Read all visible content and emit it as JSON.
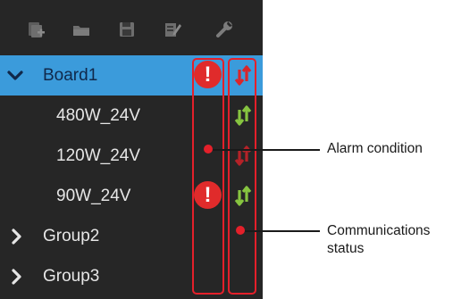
{
  "toolbar": {
    "buttons": [
      {
        "icon": "add-device-icon"
      },
      {
        "icon": "open-folder-icon"
      },
      {
        "icon": "save-disk-icon"
      },
      {
        "icon": "edit-icon"
      },
      {
        "icon": "wrench-icon"
      }
    ]
  },
  "tree": {
    "rows": [
      {
        "label": "Board1",
        "expanded": true,
        "selected": true,
        "alarm": true,
        "alarm_symbol": "!",
        "comm_status": "error"
      },
      {
        "label": "480W_24V",
        "alarm": false,
        "comm_status": "ok"
      },
      {
        "label": "120W_24V",
        "alarm": false,
        "comm_status": "error"
      },
      {
        "label": "90W_24V",
        "alarm": true,
        "alarm_symbol": "!",
        "comm_status": "ok"
      },
      {
        "label": "Group2",
        "expanded": false
      },
      {
        "label": "Group3",
        "expanded": false
      }
    ]
  },
  "callouts": {
    "alarm_condition": "Alarm condition",
    "communications_line1": "Communications",
    "communications_line2": "status"
  },
  "colors": {
    "panel_bg": "#262626",
    "selection": "#3b9bdb",
    "alarm_red": "#e02b2b",
    "comm_ok": "#86c440",
    "comm_error": "#d9262b",
    "annotation_red": "#e4202a"
  }
}
